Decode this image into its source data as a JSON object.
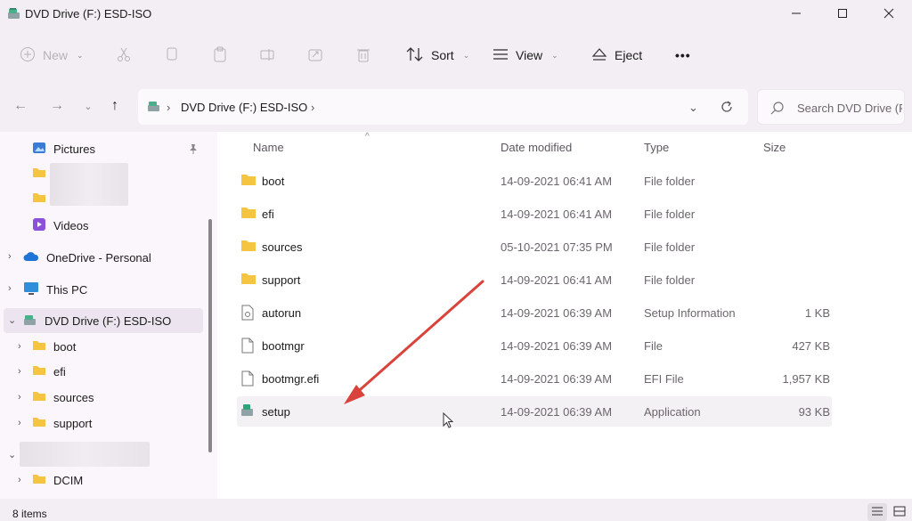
{
  "window": {
    "title": "DVD Drive (F:) ESD-ISO"
  },
  "toolbar": {
    "new_label": "New",
    "sort_label": "Sort",
    "view_label": "View",
    "eject_label": "Eject",
    "more_label": "•••"
  },
  "address": {
    "path": [
      "DVD Drive (F:) ESD-ISO"
    ],
    "search_placeholder": "Search DVD Drive (F:) ESD-ISO"
  },
  "sidebar": {
    "items": [
      {
        "label": "Pictures",
        "icon": "pictures-icon",
        "pinned": true
      },
      {
        "label": "",
        "icon": "folder-icon",
        "blurred": true
      },
      {
        "label": "",
        "icon": "folder-icon",
        "blurred": true
      },
      {
        "label": "Videos",
        "icon": "videos-icon"
      },
      {
        "label": "OneDrive - Personal",
        "icon": "onedrive-icon"
      },
      {
        "label": "This PC",
        "icon": "monitor-icon"
      },
      {
        "label": "DVD Drive (F:) ESD-ISO",
        "icon": "dvd-drive-icon",
        "selected": true
      },
      {
        "label": "boot",
        "icon": "folder-icon"
      },
      {
        "label": "efi",
        "icon": "folder-icon"
      },
      {
        "label": "sources",
        "icon": "folder-icon"
      },
      {
        "label": "support",
        "icon": "folder-icon"
      },
      {
        "label": "",
        "icon": "drive-icon",
        "blurred": true
      },
      {
        "label": "DCIM",
        "icon": "folder-icon"
      }
    ]
  },
  "columns": {
    "name": "Name",
    "date": "Date modified",
    "type": "Type",
    "size": "Size"
  },
  "files": [
    {
      "name": "boot",
      "date": "14-09-2021 06:41 AM",
      "type": "File folder",
      "size": "",
      "icon": "folder-icon"
    },
    {
      "name": "efi",
      "date": "14-09-2021 06:41 AM",
      "type": "File folder",
      "size": "",
      "icon": "folder-icon"
    },
    {
      "name": "sources",
      "date": "05-10-2021 07:35 PM",
      "type": "File folder",
      "size": "",
      "icon": "folder-icon"
    },
    {
      "name": "support",
      "date": "14-09-2021 06:41 AM",
      "type": "File folder",
      "size": "",
      "icon": "folder-icon"
    },
    {
      "name": "autorun",
      "date": "14-09-2021 06:39 AM",
      "type": "Setup Information",
      "size": "1 KB",
      "icon": "settings-file-icon"
    },
    {
      "name": "bootmgr",
      "date": "14-09-2021 06:39 AM",
      "type": "File",
      "size": "427 KB",
      "icon": "file-icon"
    },
    {
      "name": "bootmgr.efi",
      "date": "14-09-2021 06:39 AM",
      "type": "EFI File",
      "size": "1,957 KB",
      "icon": "file-icon"
    },
    {
      "name": "setup",
      "date": "14-09-2021 06:39 AM",
      "type": "Application",
      "size": "93 KB",
      "icon": "setup-app-icon"
    }
  ],
  "status": {
    "item_count": "8 items"
  },
  "colors": {
    "folder": "#f5c542",
    "annotation_arrow": "#d9433b",
    "selection": "#ece4ee"
  }
}
